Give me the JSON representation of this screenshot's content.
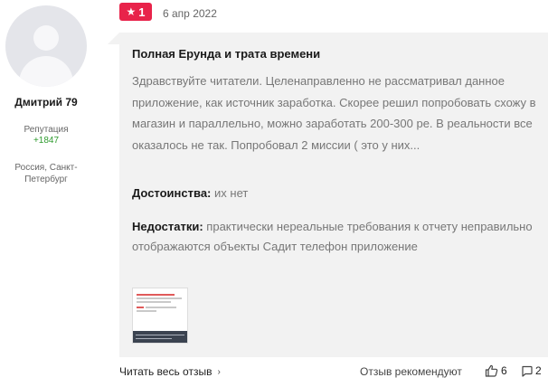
{
  "author": {
    "name": "Дмитрий 79",
    "reputation_label": "Репутация",
    "reputation_value": "+1847",
    "location": "Россия, Санкт-Петербург"
  },
  "review": {
    "rating": "1",
    "date": "6 апр 2022",
    "title": "Полная Ерунда и трата времени",
    "body": "Здравствуйте читатели. Целенаправленно не рассматривал данное приложение, как источник заработка. Скорее решил попробовать схожу в магазин и параллельно, можно заработать 200-300 ре. В реальности все оказалось не так. Попробовал 2 миссии ( это у них...",
    "pros_label": "Достоинства:",
    "pros_text": "их нет",
    "cons_label": "Недостатки:",
    "cons_text": "практически нереальные требования к отчету неправильно отображаются объекты Садит телефон приложение"
  },
  "footer": {
    "read_more": "Читать весь отзыв",
    "recommends": "Отзыв рекомендуют",
    "likes": "6",
    "comments": "2"
  },
  "colors": {
    "rating_badge": "#e8234a",
    "reputation": "#2e9b2e",
    "card_bg": "#f2f2f2"
  },
  "icons": {
    "rating": "star-icon",
    "read_more": "chevron-right-icon",
    "likes": "thumbs-up-icon",
    "comments": "comment-icon"
  }
}
